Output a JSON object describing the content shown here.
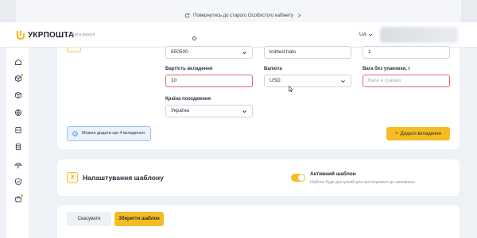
{
  "topbar": {
    "return_link": "Повернутись до старого Особистого кабінету"
  },
  "header": {
    "logo_text": "УКРПОШТА",
    "beta_label": "Бета версія",
    "language": "UA"
  },
  "form": {
    "postal_code": "650500",
    "description": "knitted hats",
    "quantity": "1",
    "value_label": "Вартість вкладення",
    "value": "10",
    "currency_label": "Валюта",
    "currency": "USD",
    "weight_label": "Вага без упаковки, г",
    "weight_placeholder": "Вага в грамах",
    "origin_label": "Країна походження",
    "origin": "Україна"
  },
  "info_note": "Можна додати ще 4 вкладення",
  "add_button": "Додати вкладення",
  "template_section": {
    "step": "3",
    "title": "Налаштування шаблону",
    "active_title": "Активний шаблон",
    "active_desc": "Шаблон буде доступний для застосування до замовлень",
    "active": true
  },
  "actions": {
    "cancel": "Скасувати",
    "save": "Зберегти шаблон"
  },
  "colors": {
    "accent": "#f5bd23",
    "error": "#e26870",
    "info_bg": "#eaf2fd"
  },
  "sidebar_icons": [
    "home-icon",
    "box-icon",
    "package-icon",
    "globe-icon",
    "stack-icon",
    "database-icon",
    "umbrella-icon",
    "shield-check-icon",
    "basket-icon"
  ]
}
